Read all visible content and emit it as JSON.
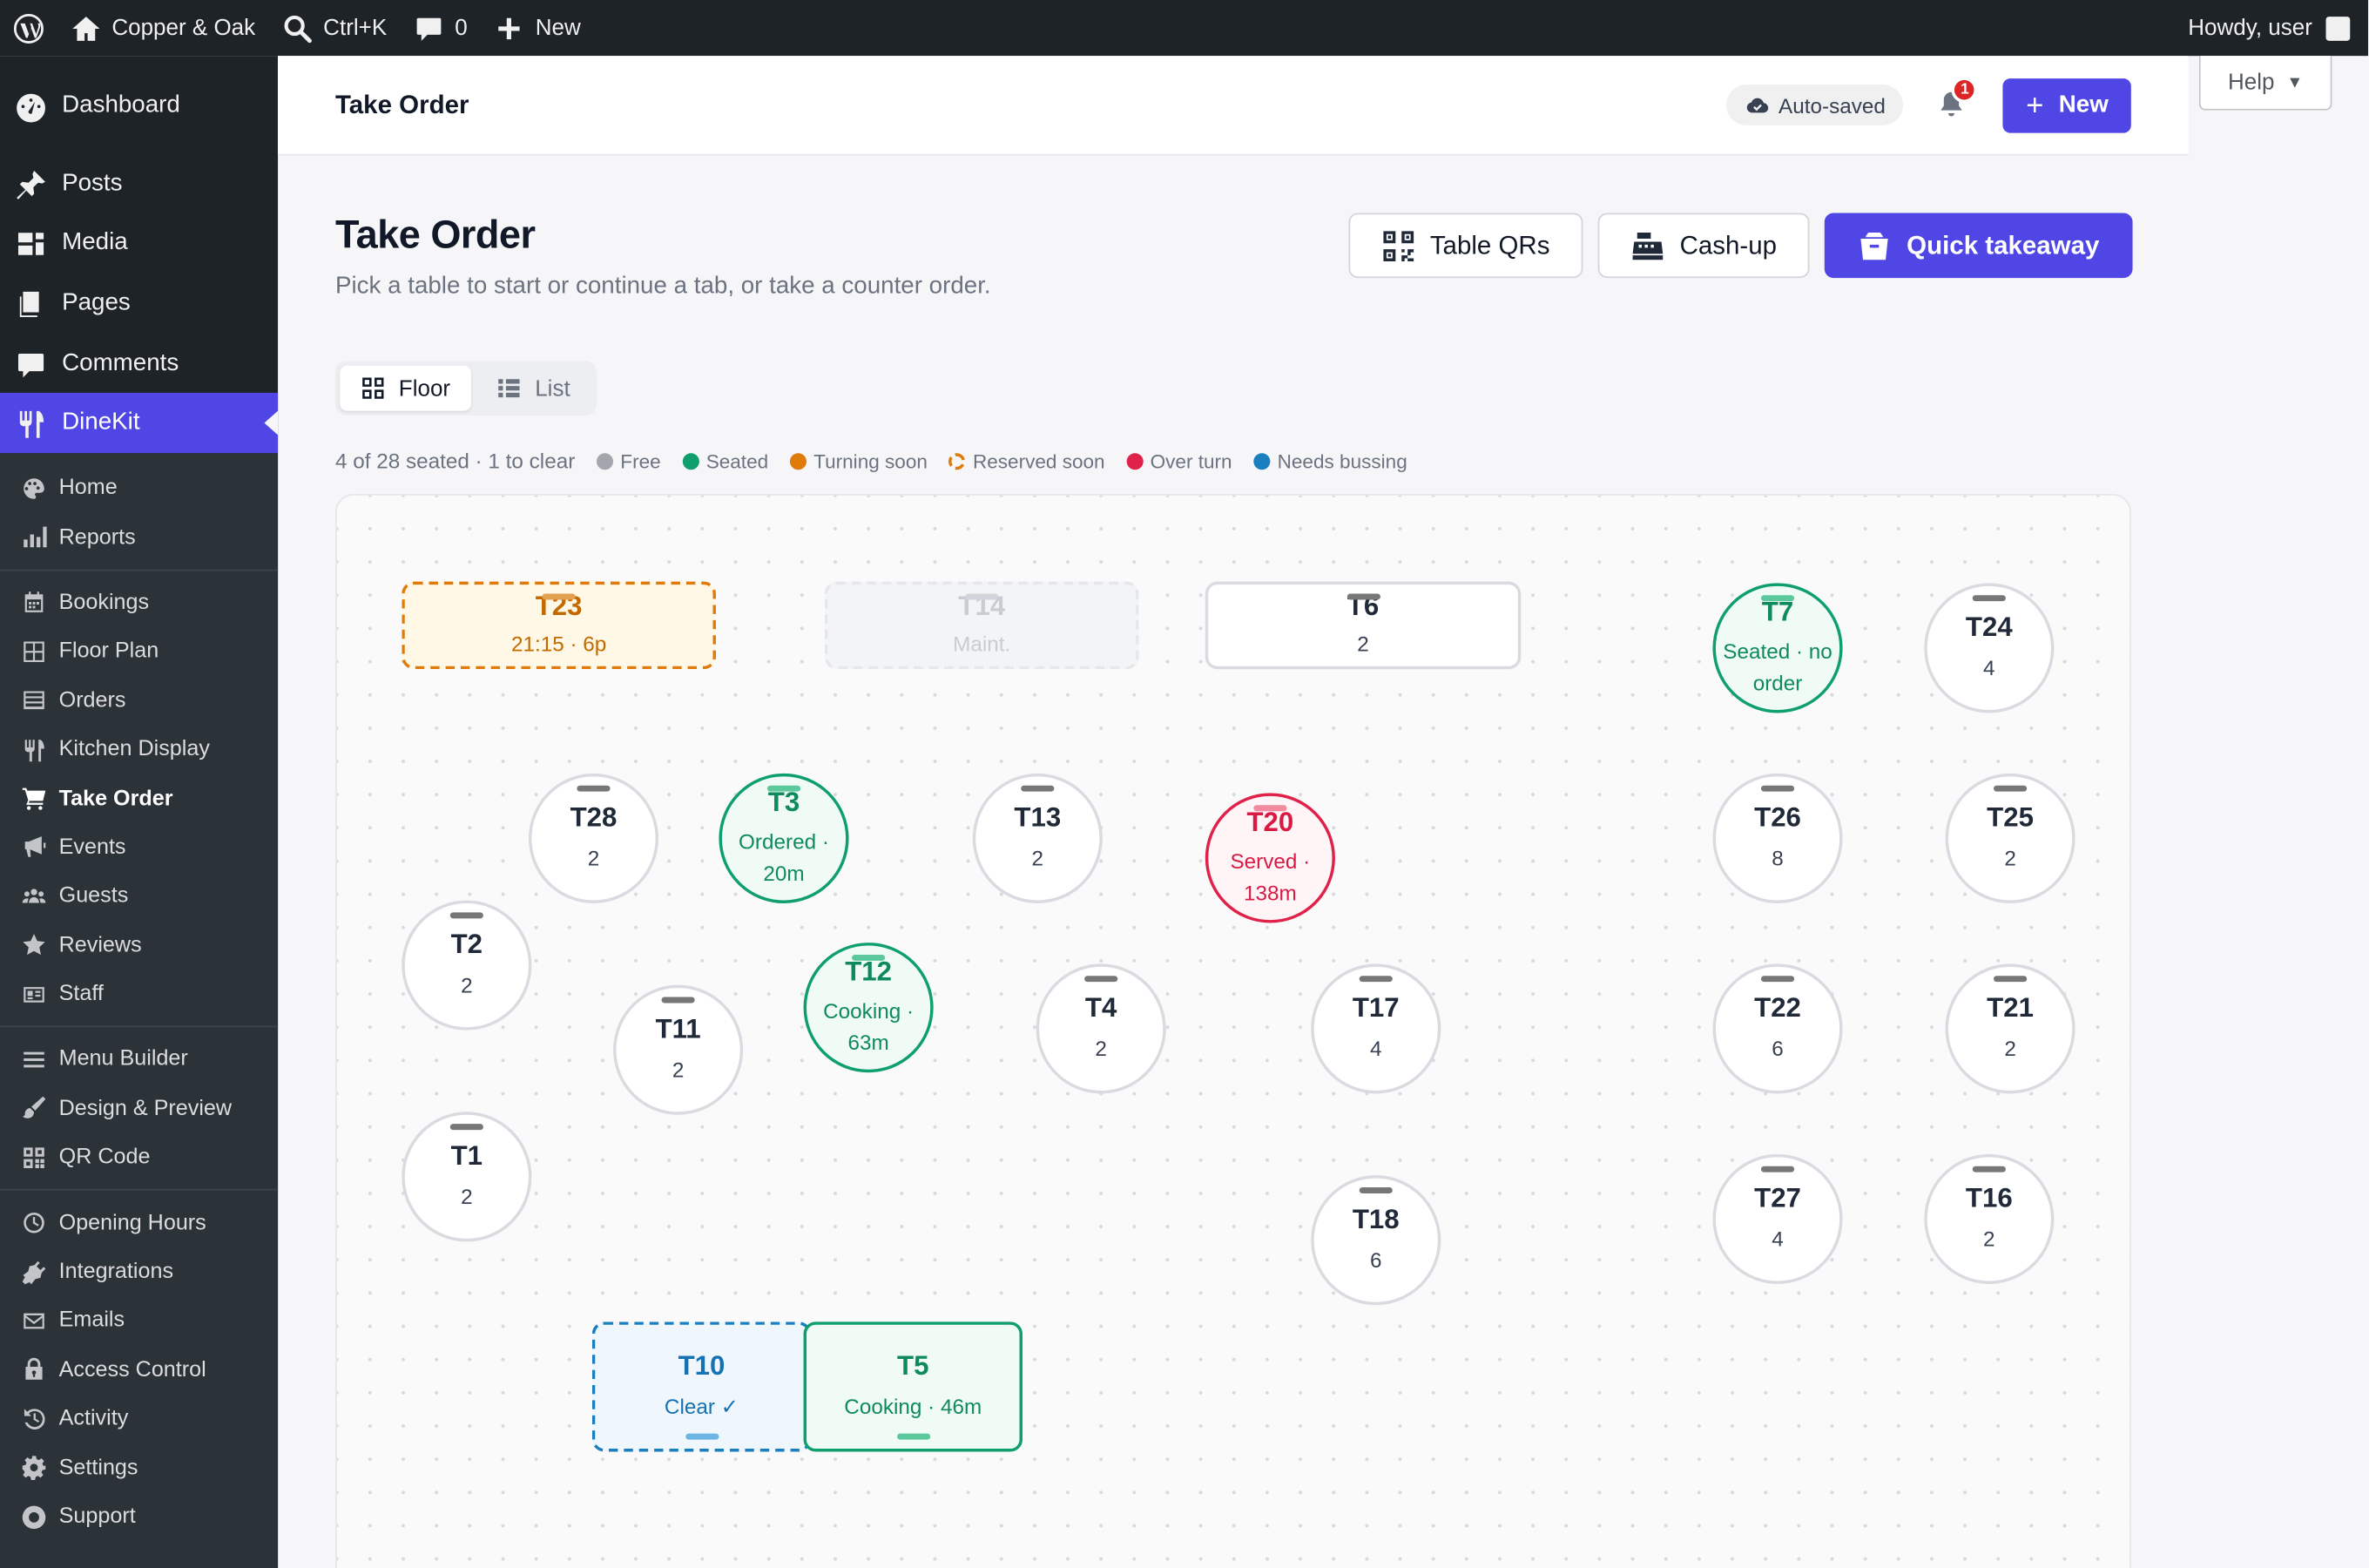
{
  "adminbar": {
    "site_name": "Copper & Oak",
    "search_shortcut": "Ctrl+K",
    "comments_count": "0",
    "new_label": "New",
    "howdy": "Howdy, user"
  },
  "sidebar": {
    "top_items": [
      {
        "label": "Dashboard",
        "icon": "dashboard-icon"
      },
      {
        "label": "Posts",
        "icon": "pin-icon"
      },
      {
        "label": "Media",
        "icon": "media-icon"
      },
      {
        "label": "Pages",
        "icon": "pages-icon"
      },
      {
        "label": "Comments",
        "icon": "comment-icon"
      },
      {
        "label": "DineKit",
        "icon": "fork-knife-icon"
      }
    ],
    "sub_groups": [
      [
        {
          "label": "Home",
          "icon": "palette-icon"
        },
        {
          "label": "Reports",
          "icon": "bar-chart-icon"
        }
      ],
      [
        {
          "label": "Bookings",
          "icon": "calendar-icon"
        },
        {
          "label": "Floor Plan",
          "icon": "grid-icon"
        },
        {
          "label": "Orders",
          "icon": "list-icon"
        },
        {
          "label": "Kitchen Display",
          "icon": "utensils-icon"
        },
        {
          "label": "Take Order",
          "icon": "cart-icon"
        },
        {
          "label": "Events",
          "icon": "megaphone-icon"
        },
        {
          "label": "Guests",
          "icon": "groups-icon"
        },
        {
          "label": "Reviews",
          "icon": "star-icon"
        },
        {
          "label": "Staff",
          "icon": "id-card-icon"
        }
      ],
      [
        {
          "label": "Menu Builder",
          "icon": "menu-icon"
        },
        {
          "label": "Design & Preview",
          "icon": "brush-icon"
        },
        {
          "label": "QR Code",
          "icon": "qr-icon"
        }
      ],
      [
        {
          "label": "Opening Hours",
          "icon": "clock-icon"
        },
        {
          "label": "Integrations",
          "icon": "plugin-icon"
        },
        {
          "label": "Emails",
          "icon": "email-icon"
        },
        {
          "label": "Access Control",
          "icon": "lock-icon"
        },
        {
          "label": "Activity",
          "icon": "history-icon"
        },
        {
          "label": "Settings",
          "icon": "gear-icon"
        },
        {
          "label": "Support",
          "icon": "support-icon"
        }
      ]
    ]
  },
  "header": {
    "title": "Take Order",
    "autosaved": "Auto-saved",
    "notifications": "1",
    "new_label": "New",
    "help_label": "Help"
  },
  "page": {
    "title": "Take Order",
    "subtitle": "Pick a table to start or continue a tab, or take a counter order.",
    "actions": {
      "table_qrs": "Table QRs",
      "cash_up": "Cash-up",
      "quick_takeaway": "Quick takeaway"
    },
    "view_toggle": {
      "floor": "Floor",
      "list": "List"
    }
  },
  "summary": "4 of 28 seated · 1 to clear",
  "legend": [
    {
      "label": "Free",
      "color": "#a3a6ad"
    },
    {
      "label": "Seated",
      "color": "#0f9f6e"
    },
    {
      "label": "Turning soon",
      "color": "#e07b0a"
    },
    {
      "label": "Reserved soon",
      "color": "#e07b0a",
      "ring": true
    },
    {
      "label": "Over turn",
      "color": "#e0224a"
    },
    {
      "label": "Needs bussing",
      "color": "#1a7fc1"
    }
  ],
  "tables": [
    {
      "name": "T23",
      "sub": "21:15 · 6p",
      "state": "reserved"
    },
    {
      "name": "T14",
      "sub": "Maint.",
      "state": "maint"
    },
    {
      "name": "T6",
      "sub": "2",
      "state": "free"
    },
    {
      "name": "T7",
      "sub": "Seated · no order",
      "state": "seated"
    },
    {
      "name": "T24",
      "sub": "4",
      "state": "free"
    },
    {
      "name": "T28",
      "sub": "2",
      "state": "free"
    },
    {
      "name": "T3",
      "sub": "Ordered · 20m",
      "state": "seated"
    },
    {
      "name": "T13",
      "sub": "2",
      "state": "free"
    },
    {
      "name": "T20",
      "sub": "Served · 138m",
      "state": "over"
    },
    {
      "name": "T26",
      "sub": "8",
      "state": "free"
    },
    {
      "name": "T25",
      "sub": "2",
      "state": "free"
    },
    {
      "name": "T2",
      "sub": "2",
      "state": "free"
    },
    {
      "name": "T12",
      "sub": "Cooking · 63m",
      "state": "seated"
    },
    {
      "name": "T11",
      "sub": "2",
      "state": "free"
    },
    {
      "name": "T4",
      "sub": "2",
      "state": "free"
    },
    {
      "name": "T17",
      "sub": "4",
      "state": "free"
    },
    {
      "name": "T22",
      "sub": "6",
      "state": "free"
    },
    {
      "name": "T21",
      "sub": "2",
      "state": "free"
    },
    {
      "name": "T1",
      "sub": "2",
      "state": "free"
    },
    {
      "name": "T18",
      "sub": "6",
      "state": "free"
    },
    {
      "name": "T27",
      "sub": "4",
      "state": "free"
    },
    {
      "name": "T16",
      "sub": "2",
      "state": "free"
    },
    {
      "name": "T10",
      "sub": "Clear ✓",
      "state": "bussing"
    },
    {
      "name": "T5",
      "sub": "Cooking · 46m",
      "state": "seated"
    }
  ]
}
